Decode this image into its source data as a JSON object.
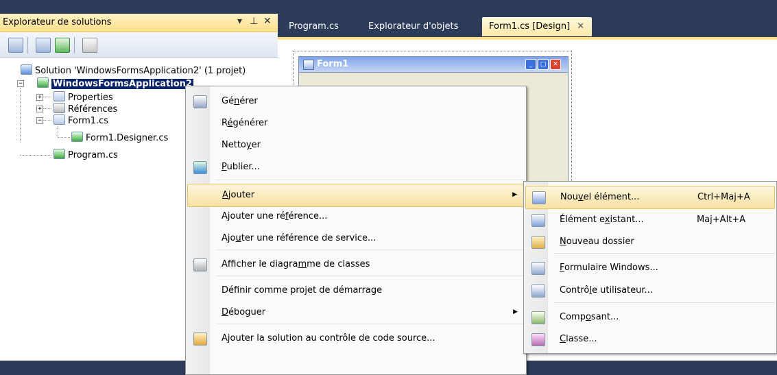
{
  "solution_explorer": {
    "title": "Explorateur de solutions",
    "pin_glyph": "▾ ꟸ",
    "close_glyph": "✕",
    "tree": {
      "solution": "Solution 'WindowsFormsApplication2' (1 projet)",
      "project": "WindowsFormsApplication2",
      "properties": "Properties",
      "references": "Références",
      "form": "Form1.cs",
      "form_designer": "Form1.Designer.cs",
      "program": "Program.cs"
    }
  },
  "tabs": [
    {
      "label": "Program.cs"
    },
    {
      "label": "Explorateur d'objets"
    },
    {
      "label": "Form1.cs [Design]"
    }
  ],
  "tab_close_glyph": "✕",
  "designer": {
    "form_title": "Form1"
  },
  "context_menu": {
    "items": [
      {
        "label_pre": "Gé",
        "label_ul": "n",
        "label_post": "érer",
        "icon": "build-icon"
      },
      {
        "label_pre": "R",
        "label_ul": "é",
        "label_post": "générer"
      },
      {
        "label_pre": "Netto",
        "label_ul": "y",
        "label_post": "er"
      },
      {
        "label_pre": "",
        "label_ul": "P",
        "label_post": "ublier...",
        "icon": "publish-icon"
      },
      {
        "label_pre": "",
        "label_ul": "A",
        "label_post": "jouter",
        "highlighted": true,
        "submenu": true
      },
      {
        "label_pre": "Ajouter une ré",
        "label_ul": "f",
        "label_post": "érence..."
      },
      {
        "label_pre": "Ajo",
        "label_ul": "u",
        "label_post": "ter une référence de service..."
      },
      {
        "label_pre": "Afficher le diagra",
        "label_ul": "m",
        "label_post": "me de classes",
        "icon": "class-diagram-icon"
      },
      {
        "label_pre": "Déf",
        "label_ul": "i",
        "label_post": "nir comme projet de démarrage"
      },
      {
        "label_pre": "",
        "label_ul": "D",
        "label_post": "éboguer",
        "submenu": true
      },
      {
        "label_pre": "Ajouter la solution au contrôle de code source...",
        "label_ul": "",
        "label_post": "",
        "icon": "source-control-icon"
      }
    ]
  },
  "add_submenu": {
    "items": [
      {
        "label_pre": "Nou",
        "label_ul": "v",
        "label_post": "el élément...",
        "shortcut": "Ctrl+Maj+A",
        "highlighted": true
      },
      {
        "label_pre": "Élément e",
        "label_ul": "x",
        "label_post": "istant...",
        "shortcut": "Maj+Alt+A"
      },
      {
        "label_pre": "",
        "label_ul": "N",
        "label_post": "ouveau dossier",
        "shortcut": ""
      },
      {
        "label_pre": "",
        "label_ul": "F",
        "label_post": "ormulaire Windows...",
        "shortcut": ""
      },
      {
        "label_pre": "Contrô",
        "label_ul": "l",
        "label_post": "e utilisateur...",
        "shortcut": ""
      },
      {
        "label_pre": "Comp",
        "label_ul": "o",
        "label_post": "sant...",
        "shortcut": ""
      },
      {
        "label_pre": "",
        "label_ul": "C",
        "label_post": "lasse...",
        "shortcut": ""
      }
    ]
  }
}
